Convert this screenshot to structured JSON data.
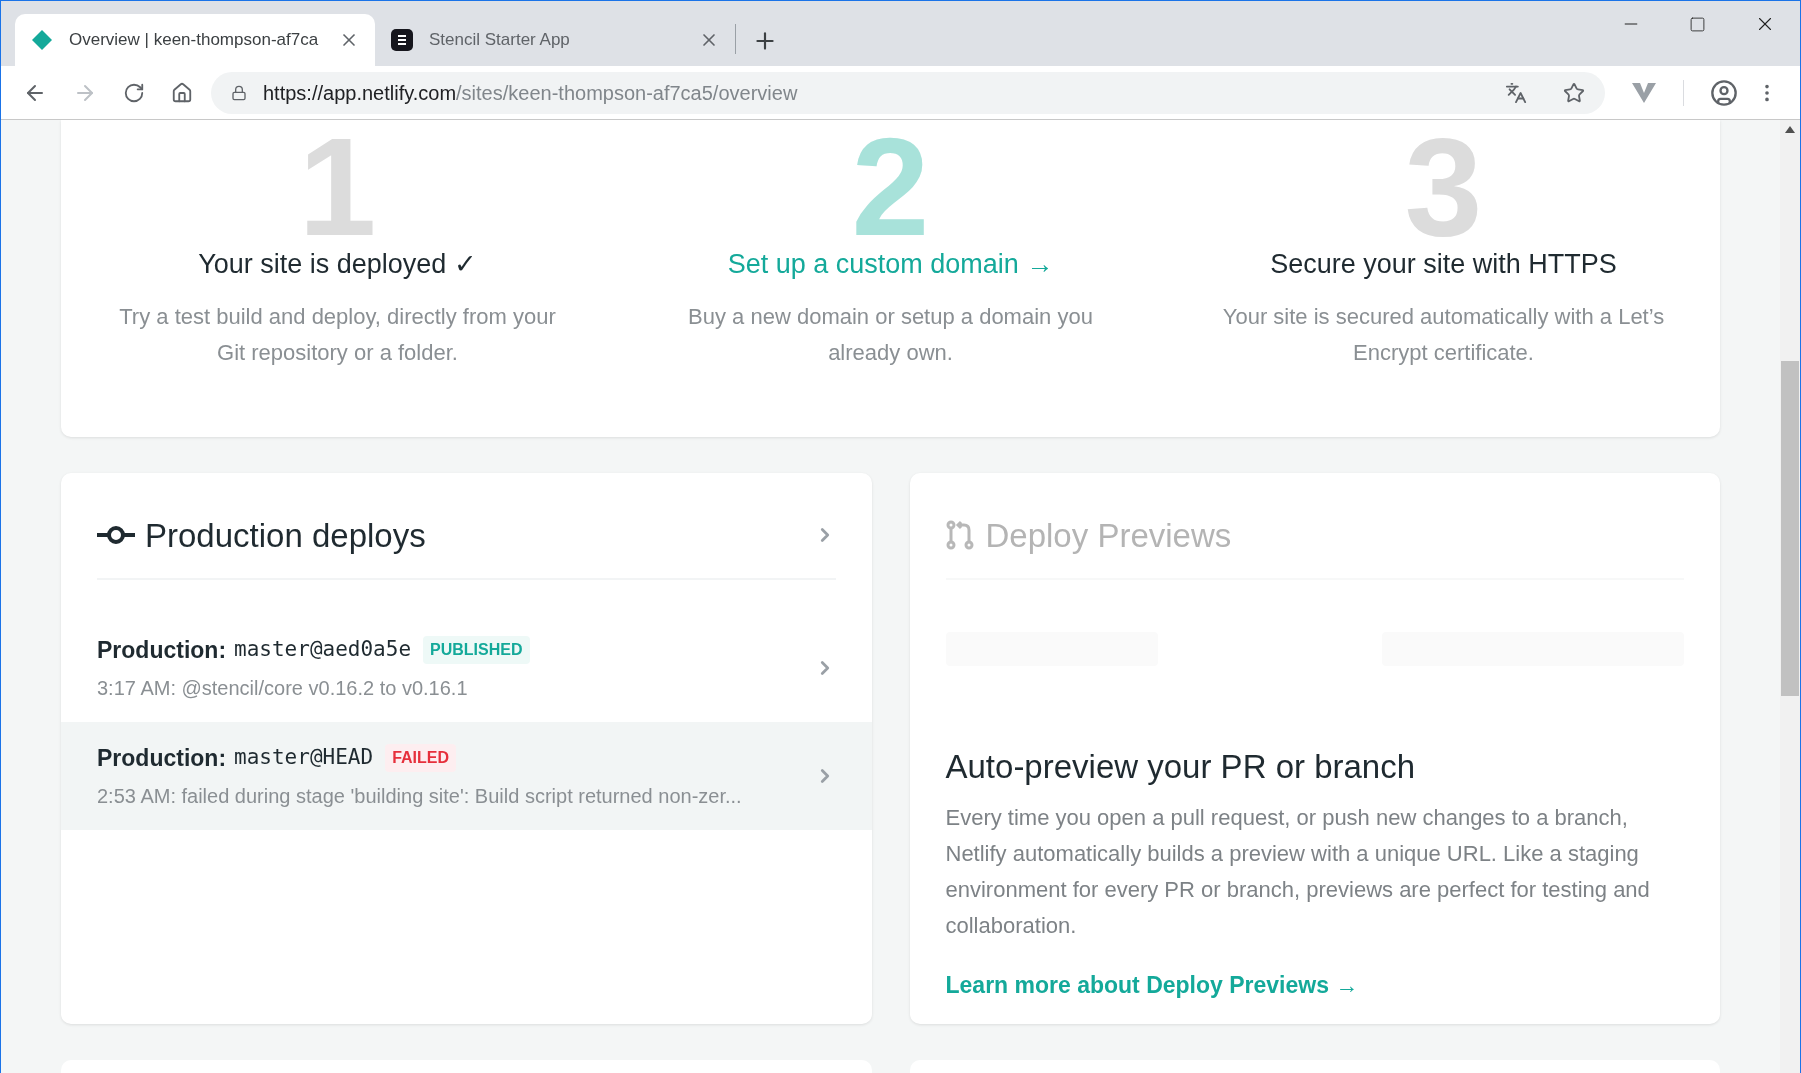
{
  "browser": {
    "tabs": [
      {
        "title": "Overview | keen-thompson-af7ca",
        "kind": "netlify",
        "selected": true
      },
      {
        "title": "Stencil Starter App",
        "kind": "stencil",
        "selected": false
      }
    ],
    "url": {
      "host": "https://app.netlify.com",
      "path": "/sites/keen-thompson-af7ca5/overview"
    }
  },
  "steps": [
    {
      "number": "1",
      "title": "Your site is deployed ✓",
      "kind": "done",
      "description": "Try a test build and deploy, directly from your Git repository or a folder."
    },
    {
      "number": "2",
      "title": "Set up a custom domain →",
      "kind": "link",
      "description": "Buy a new domain or setup a domain you already own."
    },
    {
      "number": "3",
      "title": "Secure your site with HTTPS",
      "kind": "todo",
      "description": "Your site is secured automatically with a Let’s Encrypt certificate."
    }
  ],
  "production_deploys": {
    "title": "Production deploys",
    "deploys": [
      {
        "context": "Production:",
        "ref": "master@aed0a5e",
        "status": "PUBLISHED",
        "kind": "published",
        "message": "3:17 AM: @stencil/core v0.16.2 to v0.16.1",
        "highlighted": false
      },
      {
        "context": "Production:",
        "ref": "master@HEAD",
        "status": "FAILED",
        "kind": "failed",
        "message": "2:53 AM: failed during stage 'building site': Build script returned non-zer...",
        "highlighted": true
      }
    ]
  },
  "deploy_previews": {
    "title": "Deploy Previews",
    "heading": "Auto-preview your PR or branch",
    "body": "Every time you open a pull request, or push new changes to a branch, Netlify automatically builds a preview with a unique URL. Like a staging environment for every PR or branch, previews are perfect for testing and collaboration.",
    "link": "Learn more about Deploy Previews →"
  }
}
